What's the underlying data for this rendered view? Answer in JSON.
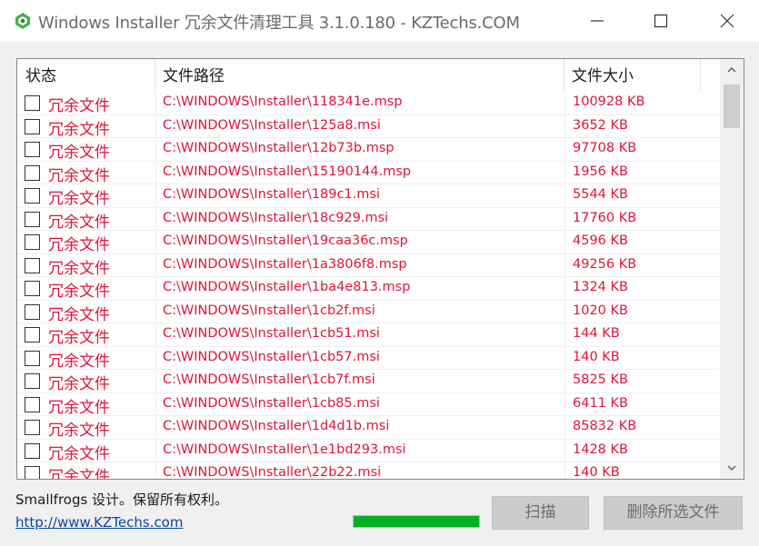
{
  "window": {
    "title": "Windows Installer 冗余文件清理工具 3.1.0.180 - KZTechs.COM",
    "accent": "#4caf50"
  },
  "columns": {
    "status": "状态",
    "path": "文件路径",
    "size": "文件大小"
  },
  "rows": [
    {
      "status": "冗余文件",
      "path": "C:\\WINDOWS\\Installer\\118341e.msp",
      "size": "100928 KB"
    },
    {
      "status": "冗余文件",
      "path": "C:\\WINDOWS\\Installer\\125a8.msi",
      "size": "3652 KB"
    },
    {
      "status": "冗余文件",
      "path": "C:\\WINDOWS\\Installer\\12b73b.msp",
      "size": "97708 KB"
    },
    {
      "status": "冗余文件",
      "path": "C:\\WINDOWS\\Installer\\15190144.msp",
      "size": "1956 KB"
    },
    {
      "status": "冗余文件",
      "path": "C:\\WINDOWS\\Installer\\189c1.msi",
      "size": "5544 KB"
    },
    {
      "status": "冗余文件",
      "path": "C:\\WINDOWS\\Installer\\18c929.msi",
      "size": "17760 KB"
    },
    {
      "status": "冗余文件",
      "path": "C:\\WINDOWS\\Installer\\19caa36c.msp",
      "size": "4596 KB"
    },
    {
      "status": "冗余文件",
      "path": "C:\\WINDOWS\\Installer\\1a3806f8.msp",
      "size": "49256 KB"
    },
    {
      "status": "冗余文件",
      "path": "C:\\WINDOWS\\Installer\\1ba4e813.msp",
      "size": "1324 KB"
    },
    {
      "status": "冗余文件",
      "path": "C:\\WINDOWS\\Installer\\1cb2f.msi",
      "size": "1020 KB"
    },
    {
      "status": "冗余文件",
      "path": "C:\\WINDOWS\\Installer\\1cb51.msi",
      "size": "144 KB"
    },
    {
      "status": "冗余文件",
      "path": "C:\\WINDOWS\\Installer\\1cb57.msi",
      "size": "140 KB"
    },
    {
      "status": "冗余文件",
      "path": "C:\\WINDOWS\\Installer\\1cb7f.msi",
      "size": "5825 KB"
    },
    {
      "status": "冗余文件",
      "path": "C:\\WINDOWS\\Installer\\1cb85.msi",
      "size": "6411 KB"
    },
    {
      "status": "冗余文件",
      "path": "C:\\WINDOWS\\Installer\\1d4d1b.msi",
      "size": "85832 KB"
    },
    {
      "status": "冗余文件",
      "path": "C:\\WINDOWS\\Installer\\1e1bd293.msi",
      "size": "1428 KB"
    },
    {
      "status": "冗余文件",
      "path": "C:\\WINDOWS\\Installer\\22b22.msi",
      "size": "140 KB"
    }
  ],
  "footer": {
    "copyright": "Smallfrogs 设计。保留所有权利。",
    "link": "http://www.KZTechs.com",
    "progress": 1.0,
    "scan_button": "扫描",
    "delete_button": "删除所选文件"
  },
  "colors": {
    "row_text": "#e0143c",
    "progress": "#06b025",
    "link": "#0645ad"
  },
  "icons": [
    "app-recycle-icon",
    "minimize-icon",
    "maximize-icon",
    "close-icon",
    "scroll-up-arrow-icon",
    "scroll-down-arrow-icon"
  ]
}
